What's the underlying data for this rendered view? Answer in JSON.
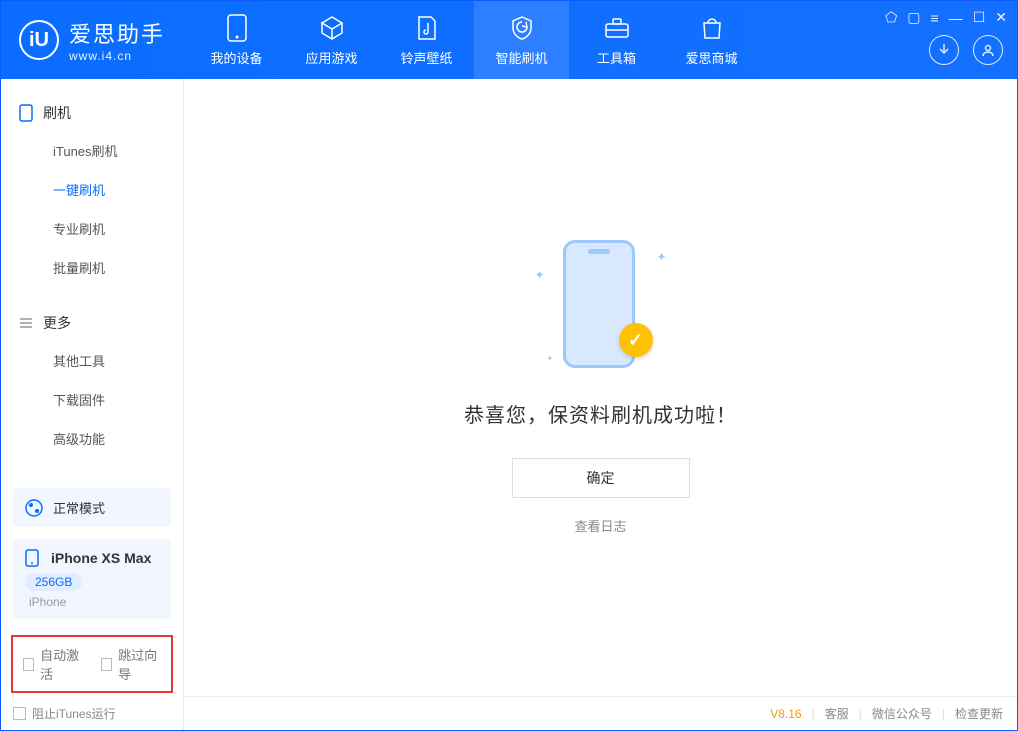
{
  "brand": {
    "name": "爱思助手",
    "url": "www.i4.cn"
  },
  "tabs": {
    "t0": "我的设备",
    "t1": "应用游戏",
    "t2": "铃声壁纸",
    "t3": "智能刷机",
    "t4": "工具箱",
    "t5": "爱思商城"
  },
  "sidebar": {
    "section1": "刷机",
    "section2": "更多",
    "item0": "iTunes刷机",
    "item1": "一键刷机",
    "item2": "专业刷机",
    "item3": "批量刷机",
    "item4": "其他工具",
    "item5": "下载固件",
    "item6": "高级功能"
  },
  "mode": {
    "label": "正常模式"
  },
  "device": {
    "name": "iPhone XS Max",
    "storage": "256GB",
    "type": "iPhone"
  },
  "checkboxes": {
    "auto_activate": "自动激活",
    "skip_guide": "跳过向导"
  },
  "bottom": {
    "block_itunes": "阻止iTunes运行"
  },
  "main": {
    "success": "恭喜您，保资料刷机成功啦！",
    "ok": "确定",
    "view_log": "查看日志"
  },
  "footer": {
    "version": "V8.16",
    "link1": "客服",
    "link2": "微信公众号",
    "link3": "检查更新"
  }
}
